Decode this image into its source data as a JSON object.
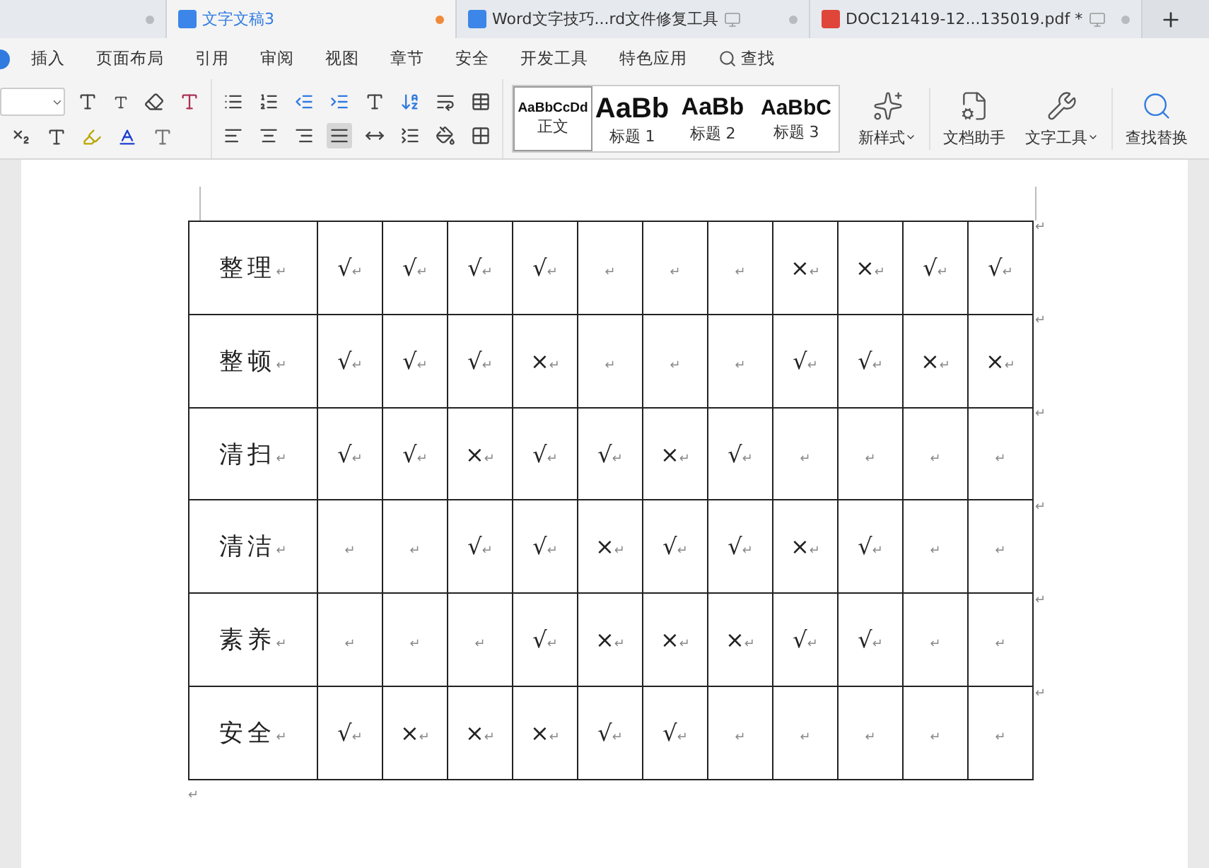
{
  "tabs": [
    {
      "kind": "blank",
      "selected": false,
      "modified": false
    },
    {
      "kind": "doc",
      "label": "文字文稿3",
      "selected": true,
      "modified": true
    },
    {
      "kind": "doc",
      "label": "Word文字技巧...rd文件修复工具",
      "selected": false,
      "modified": false
    },
    {
      "kind": "pdf",
      "label": "DOC121419-12...135019.pdf *",
      "selected": false,
      "modified": false
    }
  ],
  "menu": [
    {
      "label": "插入"
    },
    {
      "label": "页面布局"
    },
    {
      "label": "引用"
    },
    {
      "label": "审阅"
    },
    {
      "label": "视图"
    },
    {
      "label": "章节"
    },
    {
      "label": "安全"
    },
    {
      "label": "开发工具"
    },
    {
      "label": "特色应用"
    },
    {
      "label": "查找",
      "kind": "search"
    }
  ],
  "align_buttons": [
    {
      "kind": "left",
      "selected": false
    },
    {
      "kind": "center",
      "selected": false
    },
    {
      "kind": "right",
      "selected": false
    },
    {
      "kind": "justify",
      "selected": true
    },
    {
      "kind": "distribute",
      "selected": false
    }
  ],
  "styles": [
    {
      "sample": "AaBbCcDd",
      "label": "正文",
      "selected": true,
      "kind": "body"
    },
    {
      "sample": "AaBb",
      "label": "标题 1",
      "selected": false,
      "kind": "h1"
    },
    {
      "sample": "AaBb",
      "label": "标题 2",
      "selected": false,
      "kind": "h2"
    },
    {
      "sample": "AaBbC",
      "label": "标题 3",
      "selected": false,
      "kind": "h3"
    }
  ],
  "tools": [
    {
      "label": "新样式",
      "kind": "new-style",
      "dropdown": true
    },
    {
      "label": "文档助手",
      "kind": "assistant",
      "dropdown": false
    },
    {
      "label": "文字工具",
      "kind": "tools",
      "dropdown": true
    },
    {
      "label": "查找替换",
      "kind": "find",
      "dropdown": false
    }
  ],
  "table": {
    "rows": [
      {
        "label": "整理",
        "end": "↵",
        "row_end": "↵",
        "cells": [
          {
            "mark": "√",
            "end": "↵"
          },
          {
            "mark": "√",
            "end": "↵"
          },
          {
            "mark": "√",
            "end": "↵"
          },
          {
            "mark": "√",
            "end": "↵"
          },
          {
            "end": "↵"
          },
          {
            "end": "↵"
          },
          {
            "end": "↵"
          },
          {
            "mark": "×",
            "end": "↵"
          },
          {
            "mark": "×",
            "end": "↵"
          },
          {
            "mark": "√",
            "end": "↵"
          },
          {
            "mark": "√",
            "end": "↵"
          }
        ]
      },
      {
        "label": "整顿",
        "end": "↵",
        "row_end": "↵",
        "cells": [
          {
            "mark": "√",
            "end": "↵"
          },
          {
            "mark": "√",
            "end": "↵"
          },
          {
            "mark": "√",
            "end": "↵"
          },
          {
            "mark": "×",
            "end": "↵"
          },
          {
            "end": "↵"
          },
          {
            "end": "↵"
          },
          {
            "end": "↵"
          },
          {
            "mark": "√",
            "end": "↵"
          },
          {
            "mark": "√",
            "end": "↵"
          },
          {
            "mark": "×",
            "end": "↵"
          },
          {
            "mark": "×",
            "end": "↵"
          }
        ]
      },
      {
        "label": "清扫",
        "end": "↵",
        "row_end": "↵",
        "cells": [
          {
            "mark": "√",
            "end": "↵"
          },
          {
            "mark": "√",
            "end": "↵"
          },
          {
            "mark": "×",
            "end": "↵"
          },
          {
            "mark": "√",
            "end": "↵"
          },
          {
            "mark": "√",
            "end": "↵"
          },
          {
            "mark": "×",
            "end": "↵"
          },
          {
            "mark": "√",
            "end": "↵"
          },
          {
            "end": "↵"
          },
          {
            "end": "↵"
          },
          {
            "end": "↵"
          },
          {
            "end": "↵"
          }
        ]
      },
      {
        "label": "清洁",
        "end": "↵",
        "row_end": "↵",
        "cells": [
          {
            "end": "↵"
          },
          {
            "end": "↵"
          },
          {
            "mark": "√",
            "end": "↵"
          },
          {
            "mark": "√",
            "end": "↵"
          },
          {
            "mark": "×",
            "end": "↵"
          },
          {
            "mark": "√",
            "end": "↵"
          },
          {
            "mark": "√",
            "end": "↵"
          },
          {
            "mark": "×",
            "end": "↵"
          },
          {
            "mark": "√",
            "end": "↵"
          },
          {
            "end": "↵"
          },
          {
            "end": "↵"
          }
        ]
      },
      {
        "label": "素养",
        "end": "↵",
        "row_end": "↵",
        "cells": [
          {
            "end": "↵"
          },
          {
            "end": "↵"
          },
          {
            "end": "↵"
          },
          {
            "mark": "√",
            "end": "↵"
          },
          {
            "mark": "×",
            "end": "↵"
          },
          {
            "mark": "×",
            "end": "↵"
          },
          {
            "mark": "×",
            "end": "↵"
          },
          {
            "mark": "√",
            "end": "↵"
          },
          {
            "mark": "√",
            "end": "↵"
          },
          {
            "end": "↵"
          },
          {
            "end": "↵"
          }
        ]
      },
      {
        "label": "安全",
        "end": "↵",
        "row_end": "↵",
        "cells": [
          {
            "mark": "√",
            "end": "↵"
          },
          {
            "mark": "×",
            "end": "↵"
          },
          {
            "mark": "×",
            "end": "↵"
          },
          {
            "mark": "×",
            "end": "↵"
          },
          {
            "mark": "√",
            "end": "↵"
          },
          {
            "mark": "√",
            "end": "↵"
          },
          {
            "end": "↵"
          },
          {
            "end": "↵"
          },
          {
            "end": "↵"
          },
          {
            "end": "↵"
          },
          {
            "end": "↵"
          }
        ]
      }
    ]
  },
  "after_table": "↵"
}
